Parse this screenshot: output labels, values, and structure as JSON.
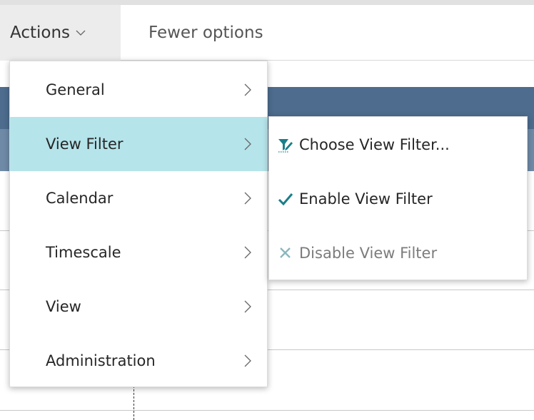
{
  "toolbar": {
    "actions_label": "Actions",
    "fewer_options_label": "Fewer options"
  },
  "menu": {
    "items": [
      {
        "label": "General"
      },
      {
        "label": "View Filter",
        "active": true
      },
      {
        "label": "Calendar"
      },
      {
        "label": "Timescale"
      },
      {
        "label": "View"
      },
      {
        "label": "Administration"
      }
    ]
  },
  "submenu": {
    "items": [
      {
        "label": "Choose View Filter...",
        "icon": "filter-edit-icon"
      },
      {
        "label": "Enable View Filter",
        "icon": "checkmark-icon"
      },
      {
        "label": "Disable View Filter",
        "icon": "close-icon",
        "disabled": true
      }
    ]
  },
  "colors": {
    "active_item": "#b5e4ea",
    "table_header": "#4d6c8e",
    "icon_teal": "#1a7e8a"
  }
}
